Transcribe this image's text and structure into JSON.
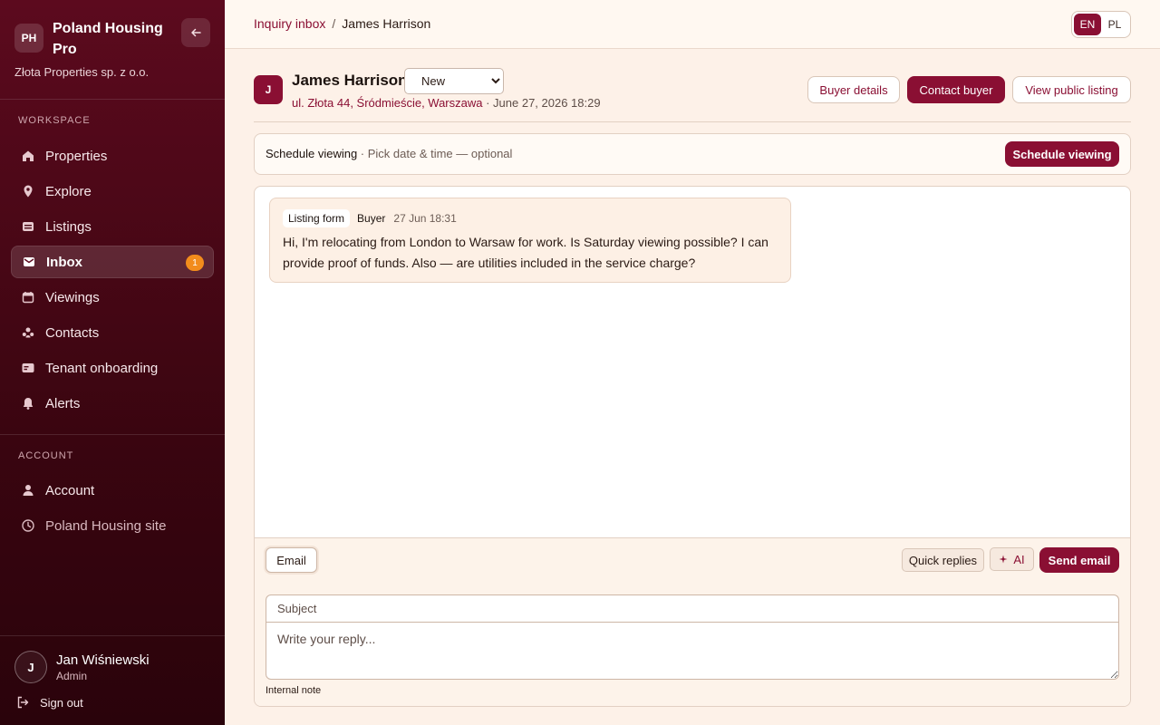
{
  "brand": {
    "logo_initials": "PH",
    "name": "Poland Housing Pro",
    "company": "Złota Properties sp. z o.o."
  },
  "sidebar": {
    "workspace_label": "WORKSPACE",
    "items": [
      {
        "label": "Properties",
        "icon": "home-icon"
      },
      {
        "label": "Explore",
        "icon": "map-pin-icon"
      },
      {
        "label": "Listings",
        "icon": "listings-icon"
      },
      {
        "label": "Inbox",
        "icon": "mail-icon",
        "badge": "1",
        "active": true
      },
      {
        "label": "Viewings",
        "icon": "calendar-icon"
      },
      {
        "label": "Contacts",
        "icon": "users-icon"
      },
      {
        "label": "Tenant onboarding",
        "icon": "id-card-icon"
      },
      {
        "label": "Alerts",
        "icon": "bell-icon"
      }
    ],
    "account_label": "ACCOUNT",
    "account_items": [
      {
        "label": "Account",
        "icon": "user-icon"
      },
      {
        "label": "Poland Housing site",
        "icon": "clock-icon"
      }
    ],
    "user": {
      "initial": "J",
      "name": "Jan Wiśniewski",
      "role": "Admin"
    },
    "sign_out": "Sign out"
  },
  "topbar": {
    "breadcrumb": {
      "parent": "Inquiry inbox",
      "separator": "/",
      "current": "James Harrison"
    },
    "languages": [
      "EN",
      "PL"
    ],
    "active_language": "EN"
  },
  "inquiry": {
    "avatar_initial": "J",
    "name": "James Harrison",
    "status": "New",
    "address": "ul. Złota 44, Śródmieście, Warszawa",
    "date": " · June 27, 2026 18:29",
    "buttons": {
      "buyer_details": "Buyer details",
      "contact_buyer": "Contact buyer",
      "view_listing": "View public listing"
    }
  },
  "schedule": {
    "title": "Schedule viewing",
    "hint": " · Pick date & time — optional",
    "button": "Schedule viewing"
  },
  "messages": [
    {
      "source": "Listing form",
      "role": "Buyer",
      "time": "27 Jun 18:31",
      "body": "Hi, I'm relocating from London to Warsaw for work. Is Saturday viewing possible? I can provide proof of funds. Also — are utilities included in the service charge?"
    }
  ],
  "composer": {
    "tab_email": "Email",
    "quick_replies": "Quick replies",
    "ai": "AI",
    "send": "Send email",
    "subject_placeholder": "Subject",
    "reply_placeholder": "Write your reply...",
    "internal_note": "Internal note"
  },
  "colors": {
    "brand": "#8a0f33",
    "badge": "#f28c1c",
    "sidebar_dark": "#3a0510"
  }
}
